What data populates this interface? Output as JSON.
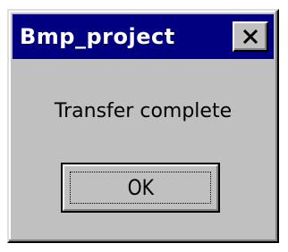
{
  "window": {
    "title": "Bmp_project",
    "close_icon": "close-icon"
  },
  "dialog": {
    "message": "Transfer complete",
    "ok_label": "OK"
  },
  "colors": {
    "titlebar": "#000080",
    "face": "#c0c0c0"
  }
}
